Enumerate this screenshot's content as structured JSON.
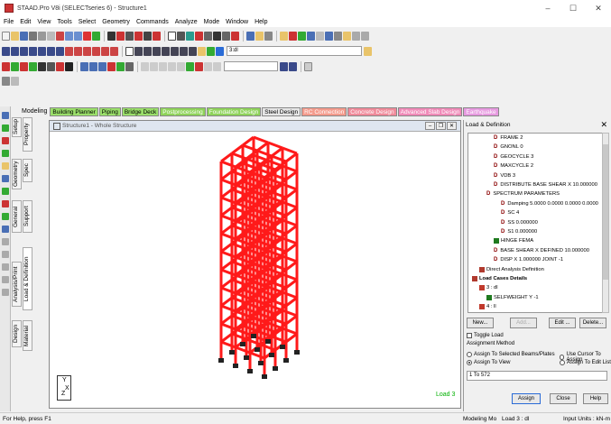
{
  "window": {
    "title": "STAAD.Pro V8i (SELECTseries 6) - Structure1",
    "minimize": "–",
    "maximize": "☐",
    "close": "✕"
  },
  "menu": [
    "File",
    "Edit",
    "View",
    "Tools",
    "Select",
    "Geometry",
    "Commands",
    "Analyze",
    "Mode",
    "Window",
    "Help"
  ],
  "toolbar": {
    "load_combo": "3:dl",
    "combo2": ""
  },
  "modes": {
    "label": "Modeling",
    "tabs": [
      {
        "label": "Building Planner",
        "color": "#9adf6a"
      },
      {
        "label": "Piping",
        "color": "#9adf6a"
      },
      {
        "label": "Bridge Deck",
        "color": "#9adf6a"
      },
      {
        "label": "Postprocessing",
        "color": "#8fd35a"
      },
      {
        "label": "Foundation Design",
        "color": "#8fd35a"
      },
      {
        "label": "Steel Design",
        "color": "#e6e6e6"
      },
      {
        "label": "RC Connection",
        "color": "#f49b8c"
      },
      {
        "label": "Concrete Design",
        "color": "#f08a9a"
      },
      {
        "label": "Advanced Slab Design",
        "color": "#f08ab8"
      },
      {
        "label": "Earthquake",
        "color": "#e79ae0"
      }
    ]
  },
  "lefttabs": {
    "setup": "Setup",
    "property": "Property",
    "geometry": "Geometry",
    "spec": "Spec",
    "general": "General",
    "support": "Support",
    "analysis": "Analysis/Print",
    "load_def": "Load & Definition",
    "design": "Design",
    "material": "Material"
  },
  "view": {
    "title": "Structure1 - Whole Structure",
    "load_label": "Load 3",
    "axis_y": "Y",
    "axis_x": "X",
    "axis_z": "Z",
    "minimize": "–",
    "restore": "❐",
    "close": "✕"
  },
  "panel": {
    "title": "Load & Definition",
    "close": "✕",
    "tree": [
      {
        "text": "FRAME 2",
        "indent": 3,
        "kind": "D"
      },
      {
        "text": "GNONL 0",
        "indent": 3,
        "kind": "D"
      },
      {
        "text": "GEOCYCLE 3",
        "indent": 3,
        "kind": "D"
      },
      {
        "text": "MAXCYCLE 2",
        "indent": 3,
        "kind": "D"
      },
      {
        "text": "VDB 3",
        "indent": 3,
        "kind": "D"
      },
      {
        "text": "DISTRIBUTE BASE SHEAR X 10.000000",
        "indent": 3,
        "kind": "D"
      },
      {
        "text": "SPECTRUM PARAMETERS",
        "indent": 2,
        "kind": "D"
      },
      {
        "text": "Damping 5.0000 0.0000 0.0000 0.0000",
        "indent": 4,
        "kind": "D"
      },
      {
        "text": "SC 4",
        "indent": 4,
        "kind": "D"
      },
      {
        "text": "SS 0.000000",
        "indent": 4,
        "kind": "D"
      },
      {
        "text": "S1 0.000000",
        "indent": 4,
        "kind": "D"
      },
      {
        "text": "HINGE FEMA",
        "indent": 3,
        "kind": "arrow"
      },
      {
        "text": "BASE SHEAR X DEFINED 10.000000",
        "indent": 3,
        "kind": "D"
      },
      {
        "text": "DISP X 1.000000 JOINT -1",
        "indent": 3,
        "kind": "D"
      },
      {
        "text": "Direct Analysis Definition",
        "indent": 1,
        "kind": "book"
      },
      {
        "text": "Load Cases Details",
        "indent": 0,
        "kind": "book",
        "bold": true
      },
      {
        "text": "3 : dl",
        "indent": 1,
        "kind": "load"
      },
      {
        "text": "SELFWEIGHT Y -1",
        "indent": 2,
        "kind": "arrow"
      },
      {
        "text": "4 : ll",
        "indent": 1,
        "kind": "load"
      }
    ],
    "buttons": {
      "new": "New...",
      "add": "Add...",
      "edit": "Edit ...",
      "delete": "Delete..."
    },
    "toggle_load": "Toggle Load",
    "assignment_method": "Assignment Method",
    "radio_selected": "Assign To Selected Beams/Plates",
    "radio_cursor": "Use Cursor To Assign",
    "radio_view": "Assign To View",
    "radio_editlist": "Assign To Edit List",
    "range_value": "1 To 572",
    "assign": "Assign",
    "close_btn": "Close",
    "help": "Help"
  },
  "status": {
    "left": "For Help, press F1",
    "mode": "Modeling Mo",
    "load": "Load 3 : dl",
    "units": "Input Units : kN-m"
  }
}
